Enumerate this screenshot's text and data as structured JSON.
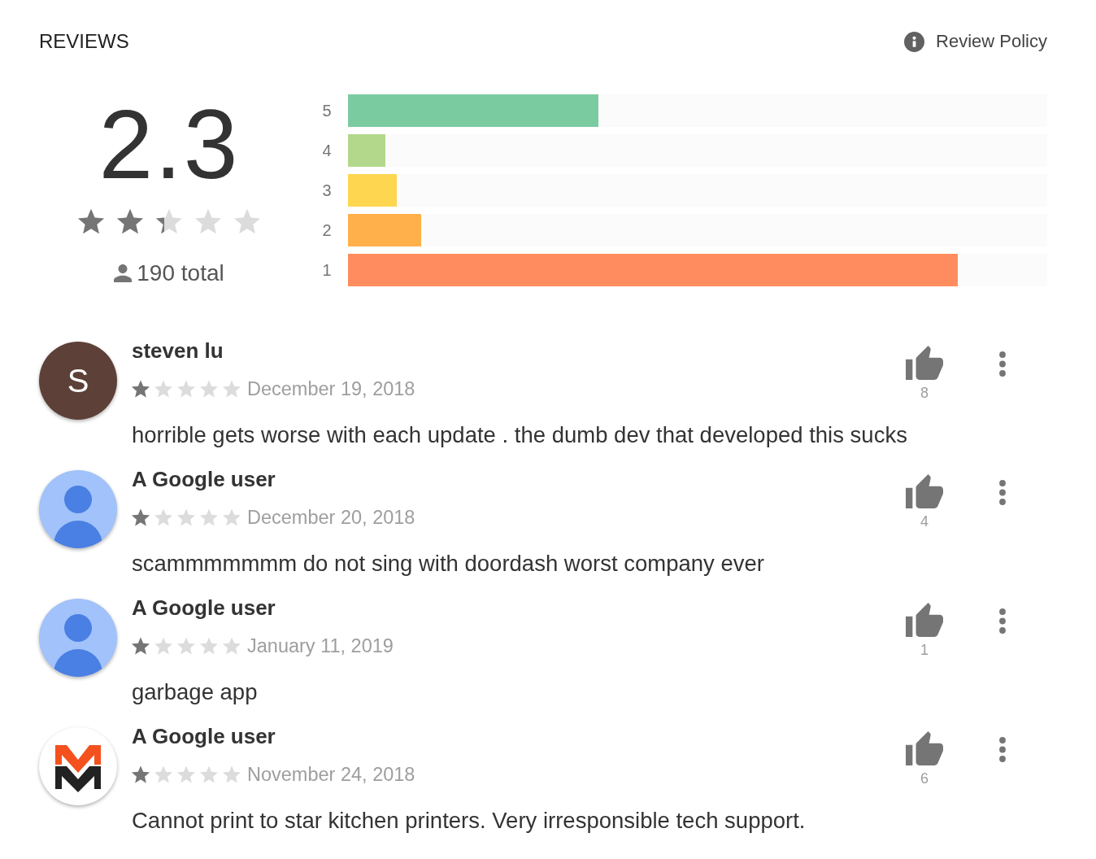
{
  "header": {
    "title": "REVIEWS",
    "policy_link": "Review Policy"
  },
  "summary": {
    "score": "2.3",
    "stars": 2.3,
    "total": "190 total"
  },
  "rating_bars": [
    {
      "label": "5",
      "level": 0.358,
      "color": "#7bcba1"
    },
    {
      "label": "4",
      "level": 0.053,
      "color": "#b3d88b"
    },
    {
      "label": "3",
      "level": 0.07,
      "color": "#ffd64f"
    },
    {
      "label": "2",
      "level": 0.105,
      "color": "#ffb04a"
    },
    {
      "label": "1",
      "level": 0.872,
      "color": "#ff8c5e"
    }
  ],
  "reviews": [
    {
      "author": "steven lu",
      "avatar": {
        "kind": "letter",
        "letter": "S",
        "color": "#5d4037"
      },
      "stars": 1,
      "date": "December 19, 2018",
      "text": "horrible gets worse with each update . the dumb dev that developed this sucks",
      "helpful_count": "8"
    },
    {
      "author": "A Google user",
      "avatar": {
        "kind": "silhouette"
      },
      "stars": 1,
      "date": "December 20, 2018",
      "text": "scammmmmmm do not sing with doordash worst company ever",
      "helpful_count": "4"
    },
    {
      "author": "A Google user",
      "avatar": {
        "kind": "silhouette"
      },
      "stars": 1,
      "date": "January 11, 2019",
      "text": "garbage app",
      "helpful_count": "1"
    },
    {
      "author": "A Google user",
      "avatar": {
        "kind": "logo"
      },
      "stars": 1,
      "date": "November 24, 2018",
      "text": "Cannot print to star kitchen printers. Very irresponsible tech support.",
      "helpful_count": "6"
    }
  ]
}
